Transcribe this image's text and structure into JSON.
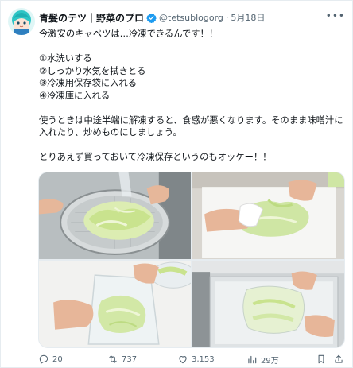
{
  "author": {
    "display_name": "青髪のテツ｜野菜のプロ",
    "handle": "@tetsublogorg",
    "separator": "·",
    "date": "5月18日",
    "verified": true
  },
  "more_icon": "more-icon",
  "tweet": {
    "lines": [
      "今激安のキャベツは…冷凍できるんです！！",
      "",
      "①水洗いする",
      "②しっかり水気を拭きとる",
      "③冷凍用保存袋に入れる",
      "④冷凍庫に入れる",
      "",
      "使うときは中途半端に解凍すると、食感が悪くなります。そのまま味噌汁に入れたり、炒めものにしましょう。",
      "",
      "とりあえず買っておいて冷凍保存というのもオッケー！！"
    ]
  },
  "media": {
    "photos": [
      {
        "subject": "rinse-cabbage-in-colander"
      },
      {
        "subject": "pat-cabbage-dry-with-towel"
      },
      {
        "subject": "put-cabbage-in-freezer-bag"
      },
      {
        "subject": "place-bag-in-freezer"
      }
    ]
  },
  "actions": {
    "replies": "20",
    "retweets": "737",
    "likes": "3,153",
    "views": "29万"
  },
  "colors": {
    "text": "#0f1419",
    "secondary": "#536471",
    "verified": "#1d9bf0",
    "avatar_hair": "#2ec5c5"
  }
}
